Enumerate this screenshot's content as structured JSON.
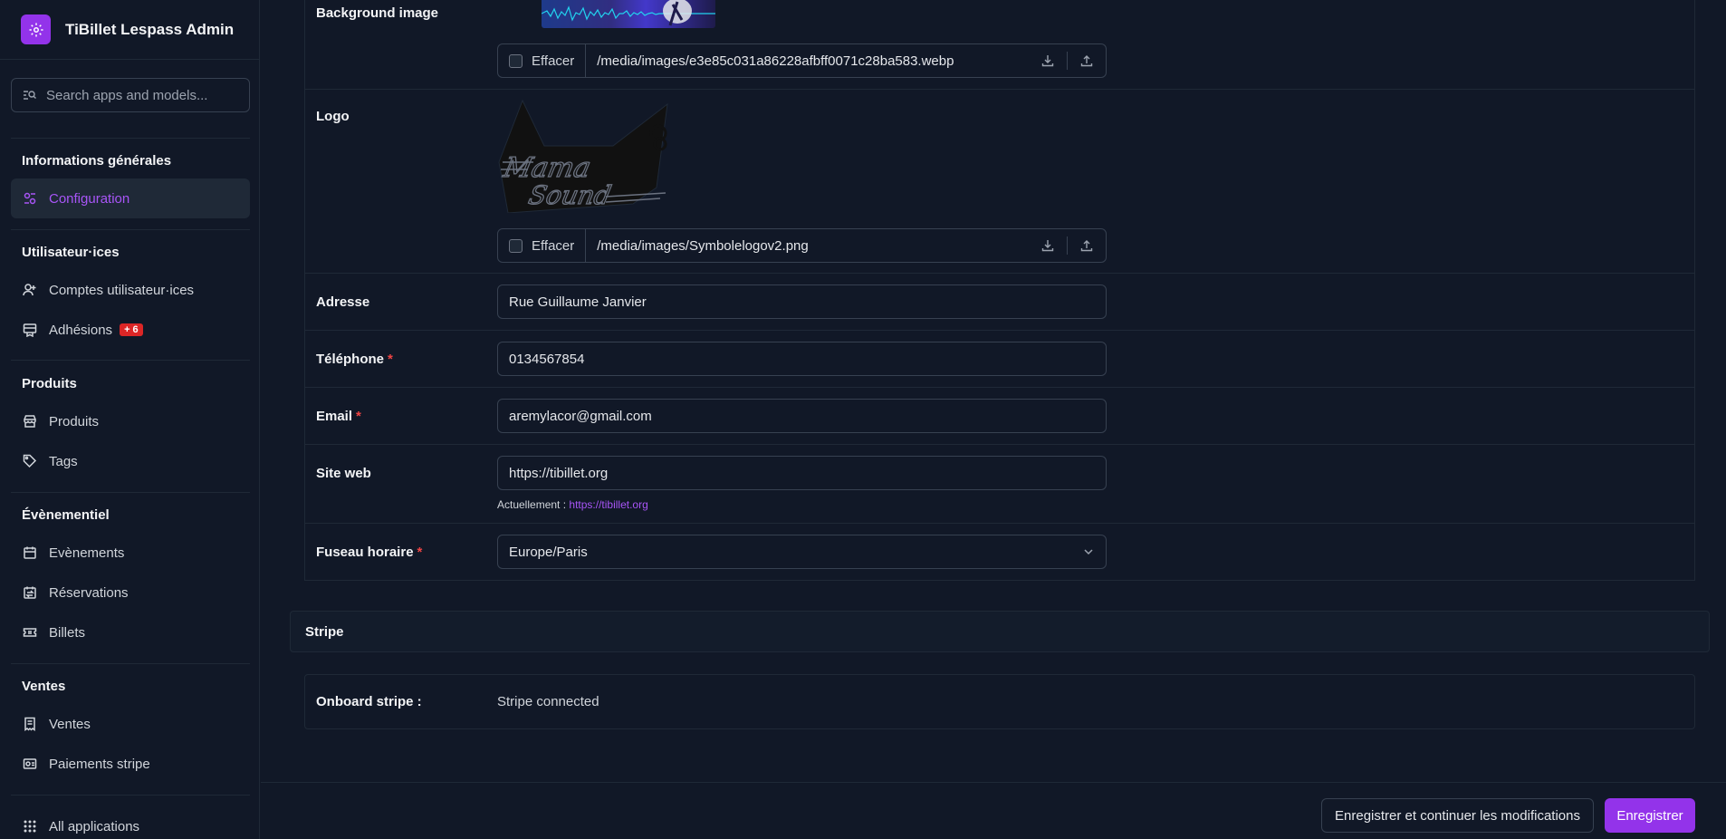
{
  "app": {
    "title": "TiBillet Lespass Admin"
  },
  "search": {
    "placeholder": "Search apps and models..."
  },
  "sidebar": {
    "sections": [
      {
        "title": "Informations générales",
        "items": [
          {
            "label": "Configuration",
            "icon": "settings-icon",
            "active": true
          }
        ]
      },
      {
        "title": "Utilisateur·ices",
        "items": [
          {
            "label": "Comptes utilisateur·ices",
            "icon": "user-plus-icon"
          },
          {
            "label": "Adhésions",
            "icon": "card-membership-icon",
            "badge": "+ 6"
          }
        ]
      },
      {
        "title": "Produits",
        "items": [
          {
            "label": "Produits",
            "icon": "storefront-icon"
          },
          {
            "label": "Tags",
            "icon": "tag-icon"
          }
        ]
      },
      {
        "title": "Évènementiel",
        "items": [
          {
            "label": "Evènements",
            "icon": "calendar-icon"
          },
          {
            "label": "Réservations",
            "icon": "calendar-swap-icon"
          },
          {
            "label": "Billets",
            "icon": "ticket-icon"
          }
        ]
      },
      {
        "title": "Ventes",
        "items": [
          {
            "label": "Ventes",
            "icon": "receipt-icon"
          },
          {
            "label": "Paiements stripe",
            "icon": "payment-icon"
          }
        ]
      }
    ],
    "all_apps": "All applications"
  },
  "form": {
    "background_image": {
      "label": "Background image",
      "clear_label": "Effacer",
      "path": "/media/images/e3e85c031a86228afbff0071c28ba583.webp"
    },
    "logo": {
      "label": "Logo",
      "clear_label": "Effacer",
      "path": "/media/images/Symbolelogov2.png"
    },
    "address": {
      "label": "Adresse",
      "value": "Rue Guillaume Janvier"
    },
    "phone": {
      "label": "Téléphone",
      "required": "*",
      "value": "0134567854"
    },
    "email": {
      "label": "Email",
      "required": "*",
      "value": "aremylacor@gmail.com"
    },
    "website": {
      "label": "Site web",
      "value": "https://tibillet.org",
      "help_prefix": "Actuellement :",
      "help_link": "https://tibillet.org"
    },
    "timezone": {
      "label": "Fuseau horaire",
      "required": "*",
      "value": "Europe/Paris"
    }
  },
  "stripe": {
    "section_title": "Stripe",
    "onboard_label": "Onboard stripe :",
    "onboard_value": "Stripe connected"
  },
  "footer": {
    "save_continue": "Enregistrer et continuer les modifications",
    "save": "Enregistrer"
  },
  "colors": {
    "accent": "#9333ea",
    "accent_text": "#a855f7",
    "badge": "#dc2626",
    "required": "#ef4444",
    "bg": "#111827"
  }
}
